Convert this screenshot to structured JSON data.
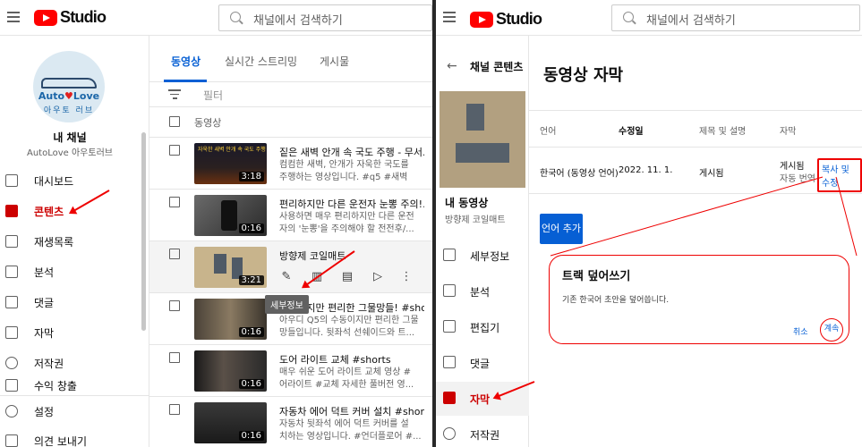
{
  "left": {
    "logo_text": "Studio",
    "search_placeholder": "채널에서 검색하기",
    "channel": {
      "avatar_line1a": "Auto",
      "avatar_heart": "♥",
      "avatar_line1b": "Love",
      "avatar_line2": "아우토 러브",
      "title": "내 채널",
      "name": "AutoLove 아우토러브"
    },
    "nav": [
      {
        "label": "대시보드",
        "icon": "dashboard-icon"
      },
      {
        "label": "콘텐츠",
        "icon": "content-icon"
      },
      {
        "label": "재생목록",
        "icon": "playlist-icon"
      },
      {
        "label": "분석",
        "icon": "analytics-icon"
      },
      {
        "label": "댓글",
        "icon": "comments-icon"
      },
      {
        "label": "자막",
        "icon": "subtitles-icon"
      },
      {
        "label": "저작권",
        "icon": "copyright-icon"
      },
      {
        "label": "수익 창출",
        "icon": "monetization-icon"
      },
      {
        "label": "설정",
        "icon": "settings-icon"
      },
      {
        "label": "의견 보내기",
        "icon": "feedback-icon"
      }
    ],
    "tabs": [
      "동영상",
      "실시간 스트리밍",
      "게시물"
    ],
    "filter_label": "필터",
    "column_header": "동영상",
    "videos": [
      {
        "title": "짙은 새벽 안개 속 국도 주행 - 무서...",
        "desc1": "컴컴한 새벽, 안개가 자욱한 국도를",
        "desc2": "주행하는 영상입니다. #q5 #새벽안...",
        "duration": "3:18",
        "thumb_caption": "자욱한 새벽 안개 속 국도 주행"
      },
      {
        "title": "편리하지만 다른 운전자 눈뽕 주의!...",
        "desc1": "사용하면 매우 편리하지만 다른 운전",
        "desc2": "자의 '눈뽕'을 주의해야 할 전전후/...",
        "duration": "0:16"
      },
      {
        "title": "방향제 코일매트",
        "desc1": "",
        "desc2": "",
        "duration": "3:21"
      },
      {
        "title": "수동이지만 편리한 그물망들! #shor...",
        "desc1": "아우디 Q5의 수동이지만 편리한 그물",
        "desc2": "망들입니다. 뒷좌석 선쉐이드와 트...",
        "duration": "0:16"
      },
      {
        "title": "도어 라이트 교체 #shorts",
        "desc1": "매우 쉬운 도어 라이트 교체 영상 #",
        "desc2": "어라이트 #교체 자세한 풀버전 영...",
        "duration": "0:16"
      },
      {
        "title": "자동차 에어 덕트 커버 설치 #shorts",
        "desc1": "자동차 뒷좌석 에어 덕트 커버를 설",
        "desc2": "치하는 영상입니다. #언더플로어 #...",
        "duration": "0:16"
      }
    ],
    "tooltip": "세부정보"
  },
  "right": {
    "logo_text": "Studio",
    "search_placeholder": "채널에서 검색하기",
    "side_title": "채널 콘텐츠",
    "video_title": "내 동영상",
    "video_subtitle": "방향제 코일매트",
    "nav": [
      {
        "label": "세부정보",
        "icon": "pencil-icon"
      },
      {
        "label": "분석",
        "icon": "analytics-icon"
      },
      {
        "label": "편집기",
        "icon": "editor-icon"
      },
      {
        "label": "댓글",
        "icon": "comments-icon"
      },
      {
        "label": "자막",
        "icon": "subtitles-icon"
      },
      {
        "label": "저작권",
        "icon": "copyright-icon"
      }
    ],
    "page_title": "동영상 자막",
    "table_headers": [
      "언어",
      "수정일",
      "제목 및 설명",
      "자막"
    ],
    "row": {
      "language": "한국어 (동영상 언어)",
      "modified": "2022. 11. 1.",
      "title_status": "게시됨",
      "sub_status1": "게시됨",
      "sub_status2": "자동 번역",
      "edit_button": "복사 및 수정"
    },
    "add_language": "언어 추가",
    "dialog": {
      "title": "트랙 덮어쓰기",
      "body": "기존 한국어 초안을 덮어씁니다.",
      "cancel": "취소",
      "continue": "계속"
    }
  },
  "colors": {
    "accent": "#065fd4",
    "highlight": "#ee0000",
    "brand_red": "#ff0000"
  }
}
